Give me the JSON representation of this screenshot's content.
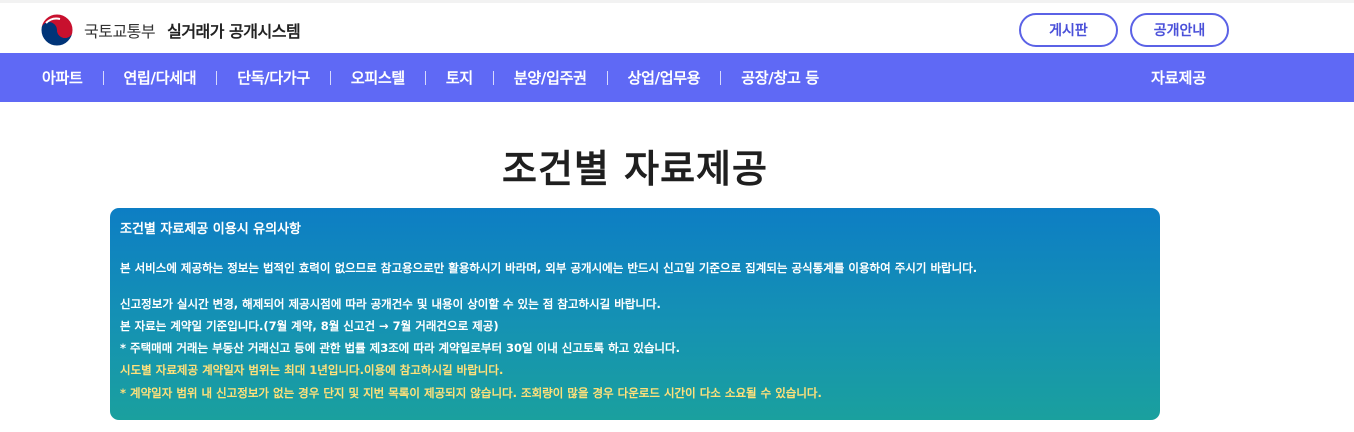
{
  "header": {
    "ministry": "국토교통부",
    "system": "실거래가 공개시스템",
    "buttons": {
      "board": "게시판",
      "guide": "공개안내"
    }
  },
  "nav": {
    "items": [
      "아파트",
      "연립/다세대",
      "단독/다가구",
      "오피스텔",
      "토지",
      "분양/입주권",
      "상업/업무용",
      "공장/창고 등"
    ],
    "right": "자료제공"
  },
  "main": {
    "title": "조건별 자료제공",
    "notice": {
      "title": "조건별 자료제공 이용시 유의사항",
      "lines": [
        "본 서비스에 제공하는 정보는 법적인 효력이 없으므로 참고용으로만 활용하시기 바라며, 외부 공개시에는 반드시 신고일 기준으로 집계되는 공식통계를 이용하여 주시기 바랍니다.",
        "신고정보가 실시간 변경, 해제되어 제공시점에 따라 공개건수 및 내용이 상이할 수 있는 점 참고하시길 바랍니다.",
        "본 자료는 계약일 기준입니다.(7월 계약, 8월 신고건 → 7월 거래건으로 제공)",
        "* 주택매매 거래는 부동산 거래신고 등에 관한 법률 제3조에 따라 계약일로부터 30일 이내 신고토록 하고 있습니다.",
        "시도별 자료제공 계약일자 범위는 최대 1년입니다.이용에 참고하시길 바랍니다.",
        "* 계약일자 범위 내 신고정보가 없는 경우 단지 및 지번 목록이 제공되지 않습니다. 조회량이 많을 경우 다운로드 시간이 다소 소요될 수 있습니다."
      ]
    }
  },
  "colors": {
    "nav_bg": "#5f69f5",
    "accent": "#5b62e6",
    "notice_highlight": "#ffe07a"
  },
  "icons": {
    "logo": "taegeuk-logo-icon"
  }
}
